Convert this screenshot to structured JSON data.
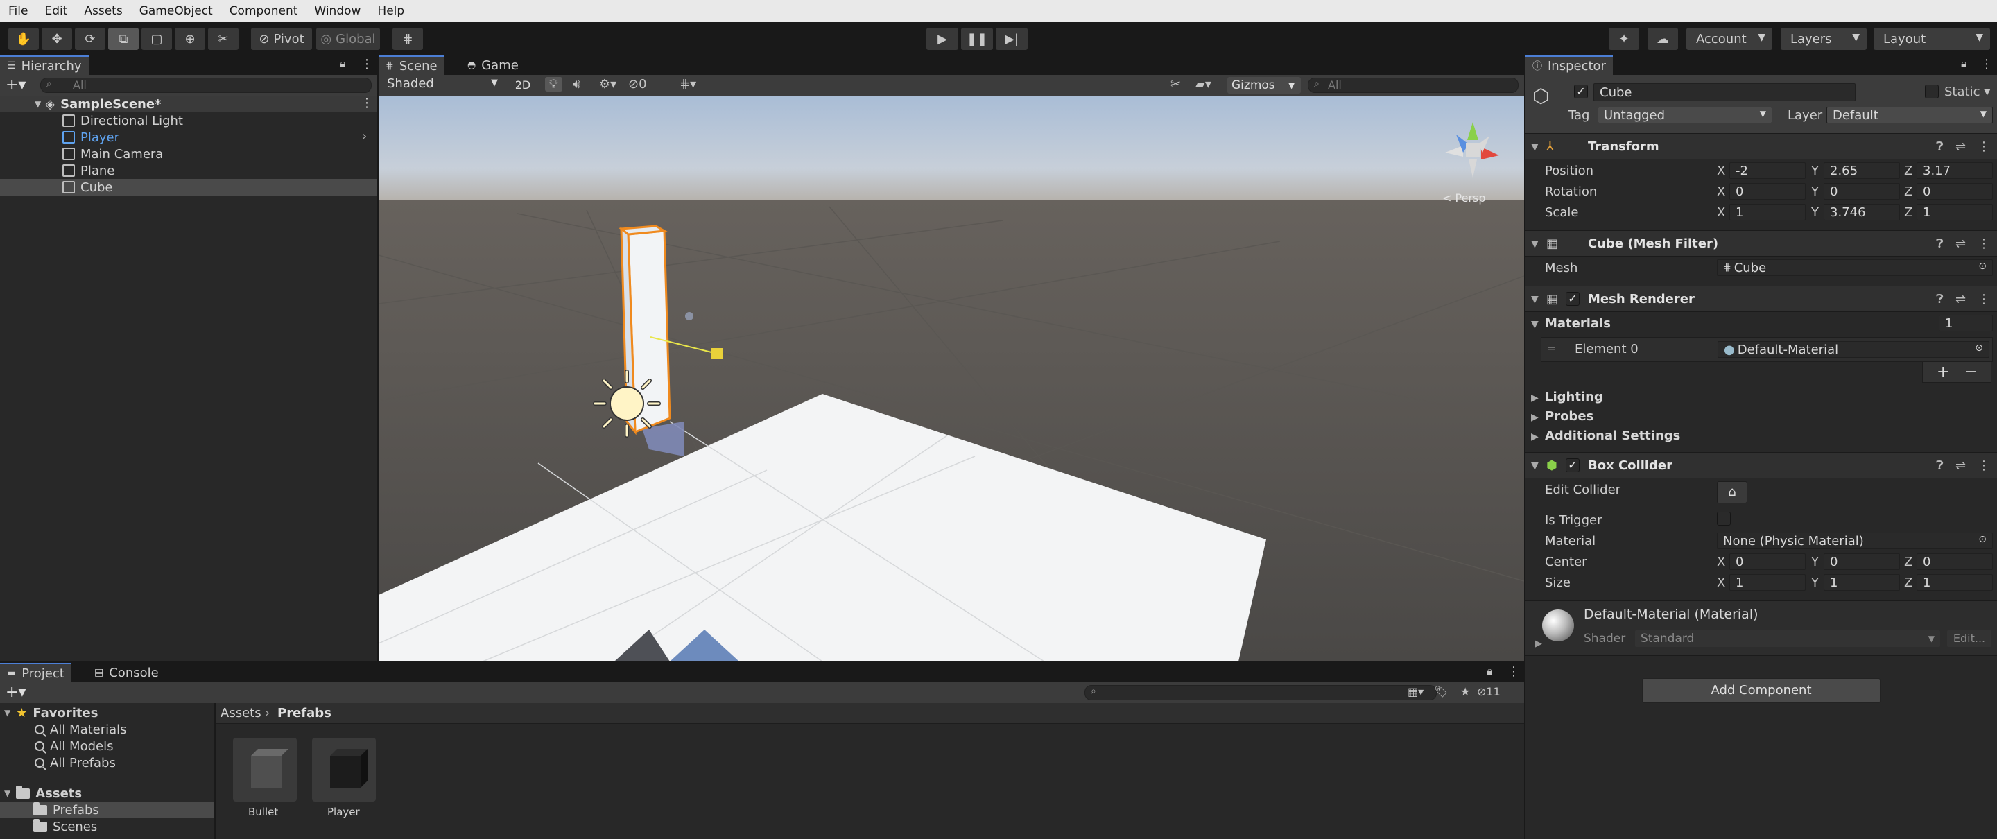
{
  "menu": [
    "File",
    "Edit",
    "Assets",
    "GameObject",
    "Component",
    "Window",
    "Help"
  ],
  "toolbar": {
    "pivot": "Pivot",
    "global": "Global",
    "account": "Account",
    "layers": "Layers",
    "layout": "Layout"
  },
  "hierarchy": {
    "tab": "Hierarchy",
    "search_placeholder": "All",
    "scene": "SampleScene*",
    "items": [
      "Directional Light",
      "Player",
      "Main Camera",
      "Plane",
      "Cube"
    ],
    "selected": "Cube"
  },
  "scene_view": {
    "tabs": [
      "Scene",
      "Game"
    ],
    "shading": "Shaded",
    "mode_2d": "2D",
    "hidden_count": "0",
    "gizmos": "Gizmos",
    "search_placeholder": "All",
    "persp": "< Persp"
  },
  "inspector": {
    "tab": "Inspector",
    "object_name": "Cube",
    "static": "Static",
    "tag_label": "Tag",
    "tag": "Untagged",
    "layer_label": "Layer",
    "layer": "Default",
    "transform": {
      "title": "Transform",
      "position_label": "Position",
      "rotation_label": "Rotation",
      "scale_label": "Scale",
      "position": {
        "x": "-2",
        "y": "2.65",
        "z": "3.17"
      },
      "rotation": {
        "x": "0",
        "y": "0",
        "z": "0"
      },
      "scale": {
        "x": "1",
        "y": "3.746",
        "z": "1"
      }
    },
    "mesh_filter": {
      "title": "Cube (Mesh Filter)",
      "mesh_label": "Mesh",
      "mesh": "Cube"
    },
    "mesh_renderer": {
      "title": "Mesh Renderer",
      "materials_label": "Materials",
      "materials_count": "1",
      "element_label": "Element 0",
      "element_value": "Default-Material",
      "lighting": "Lighting",
      "probes": "Probes",
      "additional": "Additional Settings"
    },
    "box_collider": {
      "title": "Box Collider",
      "edit_label": "Edit Collider",
      "trigger_label": "Is Trigger",
      "material_label": "Material",
      "material": "None (Physic Material)",
      "center_label": "Center",
      "size_label": "Size",
      "center": {
        "x": "0",
        "y": "0",
        "z": "0"
      },
      "size": {
        "x": "1",
        "y": "1",
        "z": "1"
      }
    },
    "material": {
      "title": "Default-Material (Material)",
      "shader_label": "Shader",
      "shader": "Standard",
      "edit": "Edit..."
    },
    "add_component": "Add Component"
  },
  "project": {
    "tabs": [
      "Project",
      "Console"
    ],
    "favorites": "Favorites",
    "fav_items": [
      "All Materials",
      "All Models",
      "All Prefabs"
    ],
    "assets": "Assets",
    "asset_folders": [
      "Prefabs",
      "Scenes"
    ],
    "breadcrumb": [
      "Assets",
      "Prefabs"
    ],
    "hidden_count": "11",
    "prefabs": [
      "Bullet",
      "Player"
    ]
  },
  "colors": {
    "accent": "#4c7fd6",
    "selection_orange": "#f08a1e",
    "panel": "#282828",
    "toolbar": "#191919"
  }
}
